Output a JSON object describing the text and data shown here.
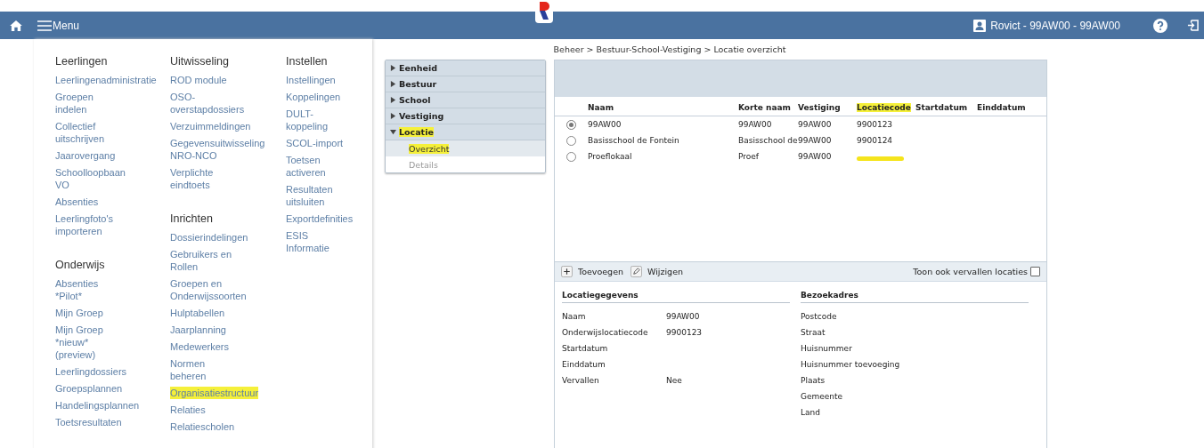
{
  "topbar": {
    "menu_label": "Menu",
    "user": "Rovict - 99AW00 - 99AW00"
  },
  "menu": {
    "columns": [
      {
        "sections": [
          {
            "heading": "Leerlingen",
            "items": [
              {
                "label": "Leerlingenadministratie",
                "highlighted": false
              },
              {
                "label": "Groepen\nindelen",
                "highlighted": false
              },
              {
                "label": "Collectief\nuitschrijven",
                "highlighted": false
              },
              {
                "label": "Jaarovergang",
                "highlighted": false
              },
              {
                "label": "Schoolloopbaan\nVO",
                "highlighted": false
              },
              {
                "label": "Absenties",
                "highlighted": false
              },
              {
                "label": "Leerlingfoto's\nimporteren",
                "highlighted": false
              }
            ]
          },
          {
            "heading": "Onderwijs",
            "items": [
              {
                "label": "Absenties\n*Pilot*",
                "highlighted": false
              },
              {
                "label": "Mijn Groep",
                "highlighted": false
              },
              {
                "label": "Mijn Groep\n*nieuw*\n(preview)",
                "highlighted": false
              },
              {
                "label": "Leerlingdossiers",
                "highlighted": false
              },
              {
                "label": "Groepsplannen",
                "highlighted": false
              },
              {
                "label": "Handelingsplannen",
                "highlighted": false
              },
              {
                "label": "Toetsresultaten",
                "highlighted": false
              }
            ]
          }
        ]
      },
      {
        "sections": [
          {
            "heading": "Uitwisseling",
            "items": [
              {
                "label": "ROD module",
                "highlighted": false
              },
              {
                "label": "OSO-\noverstapdossiers",
                "highlighted": false
              },
              {
                "label": "Verzuimmeldingen",
                "highlighted": false
              },
              {
                "label": "Gegevensuitwisseling\nNRO-NCO",
                "highlighted": false
              },
              {
                "label": "Verplichte\neindtoets",
                "highlighted": false
              }
            ]
          },
          {
            "heading": "Inrichten",
            "items": [
              {
                "label": "Dossierindelingen",
                "highlighted": false
              },
              {
                "label": "Gebruikers en\nRollen",
                "highlighted": false
              },
              {
                "label": "Groepen en\nOnderwijssoorten",
                "highlighted": false
              },
              {
                "label": "Hulptabellen",
                "highlighted": false
              },
              {
                "label": "Jaarplanning",
                "highlighted": false
              },
              {
                "label": "Medewerkers",
                "highlighted": false
              },
              {
                "label": "Normen\nbeheren",
                "highlighted": false
              },
              {
                "label": "Organisatiestructuur",
                "highlighted": true
              },
              {
                "label": "Relaties",
                "highlighted": false
              },
              {
                "label": "Relatiescholen",
                "highlighted": false
              }
            ]
          }
        ]
      },
      {
        "sections": [
          {
            "heading": "Instellen",
            "items": [
              {
                "label": "Instellingen",
                "highlighted": false
              },
              {
                "label": "Koppelingen",
                "highlighted": false
              },
              {
                "label": "DULT-\nkoppeling",
                "highlighted": false
              },
              {
                "label": "SCOL-import",
                "highlighted": false
              },
              {
                "label": "Toetsen\nactiveren",
                "highlighted": false
              },
              {
                "label": "Resultaten\nuitsluiten",
                "highlighted": false
              },
              {
                "label": "Exportdefinities",
                "highlighted": false
              },
              {
                "label": "ESIS\nInformatie",
                "highlighted": false
              }
            ]
          }
        ]
      }
    ]
  },
  "breadcrumb": "Beheer > Bestuur-School-Vestiging > Locatie overzicht",
  "tree": [
    {
      "label": "Eenheid",
      "expanded": false,
      "highlighted": false
    },
    {
      "label": "Bestuur",
      "expanded": false,
      "highlighted": false
    },
    {
      "label": "School",
      "expanded": false,
      "highlighted": false
    },
    {
      "label": "Vestiging",
      "expanded": false,
      "highlighted": false
    },
    {
      "label": "Locatie",
      "expanded": true,
      "highlighted": true,
      "children": [
        {
          "label": "Overzicht",
          "selected": true,
          "highlighted": true
        },
        {
          "label": "Details",
          "selected": false,
          "highlighted": false
        }
      ]
    }
  ],
  "table": {
    "columns": [
      {
        "label": "Naam",
        "highlighted": false
      },
      {
        "label": "Korte naam",
        "highlighted": false
      },
      {
        "label": "Vestiging",
        "highlighted": false
      },
      {
        "label": "Locatiecode",
        "highlighted": true
      },
      {
        "label": "Startdatum",
        "highlighted": false
      },
      {
        "label": "Einddatum",
        "highlighted": false
      }
    ],
    "rows": [
      {
        "selected": true,
        "naam": "99AW00",
        "korte_naam": "99AW00",
        "vestiging": "99AW00",
        "locatiecode": "9900123",
        "code_marked": false
      },
      {
        "selected": false,
        "naam": "Basisschool de Fontein",
        "korte_naam": "Basisschool de",
        "vestiging": "99AW00",
        "locatiecode": "9900124",
        "code_marked": false
      },
      {
        "selected": false,
        "naam": "Proeflokaal",
        "korte_naam": "Proef",
        "vestiging": "99AW00",
        "code_marked": true
      }
    ]
  },
  "toolbar": {
    "add": "Toevoegen",
    "edit": "Wijzigen",
    "show_expired": {
      "label": "Toon ook vervallen locaties",
      "checked": false
    }
  },
  "details": [
    {
      "heading": "Locatiegegevens",
      "fields": [
        {
          "label": "Naam",
          "value": "99AW00"
        },
        {
          "label": "Onderwijslocatiecode",
          "value": "9900123"
        },
        {
          "label": "Startdatum"
        },
        {
          "label": "Einddatum"
        },
        {
          "label": "Vervallen",
          "value": "Nee"
        }
      ]
    },
    {
      "heading": "Bezoekadres",
      "fields": [
        {
          "label": "Postcode"
        },
        {
          "label": "Straat"
        },
        {
          "label": "Huisnummer"
        },
        {
          "label": "Huisnummer toevoeging"
        },
        {
          "label": "Plaats"
        },
        {
          "label": "Gemeente"
        },
        {
          "label": "Land"
        }
      ]
    }
  ]
}
